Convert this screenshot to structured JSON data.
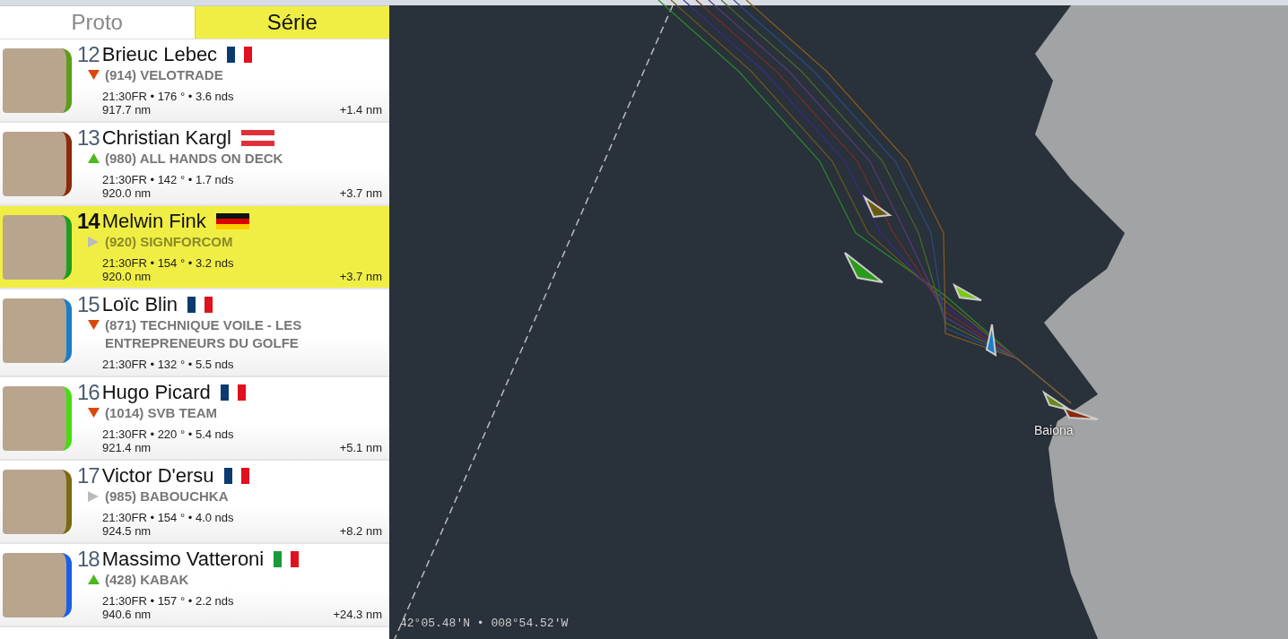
{
  "tabs": [
    {
      "label": "Proto",
      "selected": false
    },
    {
      "label": "Série",
      "selected": true
    }
  ],
  "racers": [
    {
      "rank": "12",
      "name": "Brieuc Lebec",
      "flag": {
        "kind": "fr"
      },
      "trend": {
        "kind": "down"
      },
      "boat": "(914) VELOTRADE",
      "info": "21:30FR • 176 ° • 3.6 nds",
      "distance": "917.7 nm",
      "gap": "+1.4 nm",
      "color": "#5a9e1a",
      "selected": false
    },
    {
      "rank": "13",
      "name": "Christian Kargl",
      "flag": {
        "kind": "at"
      },
      "trend": {
        "kind": "up"
      },
      "boat": "(980) ALL HANDS ON DECK",
      "info": "21:30FR • 142 ° • 1.7 nds",
      "distance": "920.0 nm",
      "gap": "+3.7 nm",
      "color": "#8a2a0a",
      "selected": false
    },
    {
      "rank": "14",
      "name": "Melwin Fink",
      "flag": {
        "kind": "de"
      },
      "trend": {
        "kind": "same"
      },
      "boat": "(920) SIGNFORCOM",
      "info": "21:30FR • 154 ° • 3.2 nds",
      "distance": "920.0 nm",
      "gap": "+3.7 nm",
      "color": "#1e9e1e",
      "selected": true
    },
    {
      "rank": "15",
      "name": "Loïc Blin",
      "flag": {
        "kind": "fr"
      },
      "trend": {
        "kind": "down"
      },
      "boat": "(871) TECHNIQUE VOILE - LES ENTREPRENEURS DU GOLFE",
      "info": "21:30FR • 132 ° • 5.5 nds",
      "color": "#1a7ec8",
      "selected": false
    },
    {
      "rank": "16",
      "name": "Hugo Picard",
      "flag": {
        "kind": "fr"
      },
      "trend": {
        "kind": "down"
      },
      "boat": "(1014) SVB TEAM",
      "info": "21:30FR • 220 ° • 5.4 nds",
      "distance": "921.4 nm",
      "gap": "+5.1 nm",
      "color": "#44dd11",
      "selected": false
    },
    {
      "rank": "17",
      "name": "Victor D'ersu",
      "flag": {
        "kind": "fr"
      },
      "trend": {
        "kind": "same"
      },
      "boat": "(985) BABOUCHKA",
      "info": "21:30FR • 154 ° • 4.0 nds",
      "distance": "924.5 nm",
      "gap": "+8.2 nm",
      "color": "#7a6a10",
      "selected": false
    },
    {
      "rank": "18",
      "name": "Massimo Vatteroni",
      "flag": {
        "kind": "it"
      },
      "trend": {
        "kind": "up"
      },
      "boat": "(428) KABAK",
      "info": "21:30FR • 157 ° • 2.2 nds",
      "distance": "940.6 nm",
      "gap": "+24.3 nm",
      "color": "#1a5ee8",
      "selected": false
    }
  ],
  "map": {
    "place_label": "Baiona",
    "coordinates": "42°05.48'N • 008°54.52'W"
  }
}
